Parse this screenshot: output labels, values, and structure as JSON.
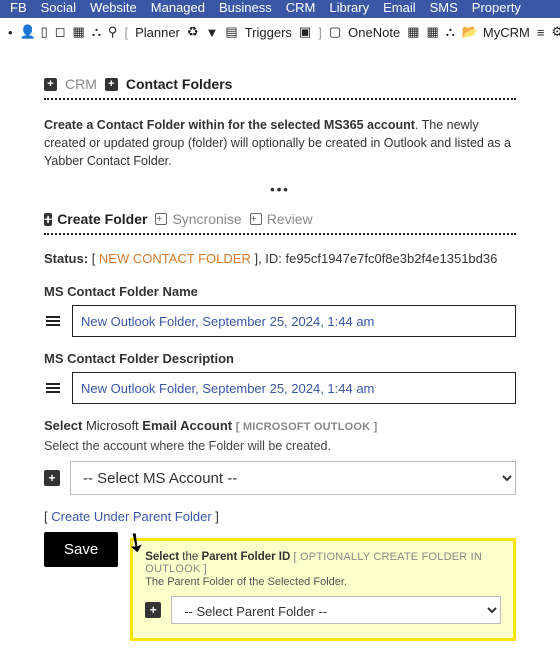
{
  "topnav": {
    "items": [
      "FB",
      "Social",
      "Website",
      "Managed",
      "Business",
      "CRM",
      "Library",
      "Email",
      "SMS",
      "Property"
    ]
  },
  "toolbar": {
    "planner": "Planner",
    "triggers": "Triggers",
    "onenote": "OneNote",
    "mycrm": "MyCRM"
  },
  "breadcrumb": {
    "crm": "CRM",
    "folders": "Contact Folders"
  },
  "intro": {
    "bold": "Create a Contact Folder within for the selected MS365 account",
    "rest": ". The newly created or updated group (folder) will optionally be created in Outlook and listed as a Yabber Contact Folder."
  },
  "tabs": {
    "create": "Create Folder",
    "sync": "Syncronise",
    "review": "Review"
  },
  "status": {
    "label": "Status:",
    "state": "NEW CONTACT FOLDER",
    "id_label": "ID:",
    "id": "fe95cf1947e7fc0f8e3b2f4e1351bd36"
  },
  "folder_name": {
    "label": "MS Contact Folder Name",
    "value": "New Outlook Folder, September 25, 2024, 1:44 am"
  },
  "folder_desc": {
    "label": "MS Contact Folder Description",
    "value": "New Outlook Folder, September 25, 2024, 1:44 am"
  },
  "account": {
    "label_a": "Select",
    "label_b": "Microsoft",
    "label_c": "Email Account",
    "tag": "[ MICROSOFT OUTLOOK ]",
    "help": "Select the account where the Folder will be created.",
    "placeholder": "-- Select MS Account --"
  },
  "parent_link": {
    "open": "[ ",
    "text": "Create Under Parent Folder",
    "close": " ]"
  },
  "parent_box": {
    "line_a_pre": "Select",
    "line_a_mid": " the ",
    "line_a_bold": "Parent Folder ID",
    "tag": "[ OPTIONALLY CREATE FOLDER IN OUTLOOK ]",
    "line_b": "The Parent Folder of the Selected Folder.",
    "placeholder": "-- Select Parent Folder --"
  },
  "save": "Save"
}
